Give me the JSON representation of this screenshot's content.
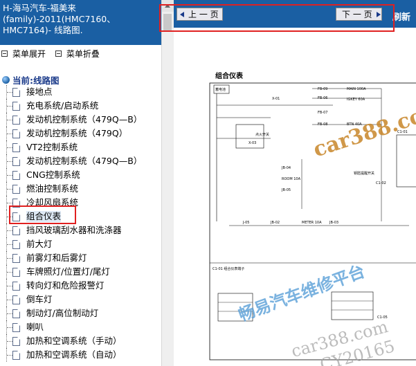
{
  "sidebar": {
    "title_lines": [
      "H-海马汽车-福美来",
      "(family)-2011(HMC7160、",
      "HMC7164)- 线路图."
    ],
    "expand_label": "菜单展开",
    "collapse_label": "菜单折叠",
    "tree_root": "当前:线路图",
    "items": [
      {
        "label": "接地点"
      },
      {
        "label": "充电系统/启动系统"
      },
      {
        "label": "发动机控制系统（479Q—B）"
      },
      {
        "label": "发动机控制系统（479Q）"
      },
      {
        "label": "VT2控制系统"
      },
      {
        "label": "发动机控制系统（479Q—B）"
      },
      {
        "label": "CNG控制系统"
      },
      {
        "label": "燃油控制系统"
      },
      {
        "label": "冷却风扇系统"
      },
      {
        "label": "组合仪表"
      },
      {
        "label": "挡风玻璃刮水器和洗涤器"
      },
      {
        "label": "前大灯"
      },
      {
        "label": "前雾灯和后雾灯"
      },
      {
        "label": "车牌照灯/位置灯/尾灯"
      },
      {
        "label": "转向灯和危险报警灯"
      },
      {
        "label": "倒车灯"
      },
      {
        "label": "制动灯/高位制动灯"
      },
      {
        "label": "喇叭"
      },
      {
        "label": "加热和空调系统（手动）"
      },
      {
        "label": "加热和空调系统（自动）"
      }
    ],
    "selected_index": 9
  },
  "toolbar": {
    "prev_label": "上 一 页",
    "next_label": "下 一 页",
    "refresh_label": "刷新"
  },
  "diagram": {
    "title": "组合仪表",
    "labels": {
      "fuse_box": "蓄电池",
      "ignition_switch": "点火开关",
      "lighting_control": "钥匙提醒开关",
      "ground": "C1-01 组合仪表端子",
      "f8": "FB-09",
      "f6": "FB-06",
      "f7": "FB-07",
      "f5": "FB-08",
      "main": "MAIN 100A",
      "igkey": "IGKEY 60A",
      "btn": "BTN 40A",
      "room": "ROOM 10A",
      "meter": "METER 10A",
      "x01": "X-01",
      "x03": "X-03",
      "jb04": "JB-04",
      "jb05": "JB-05",
      "jb02": "JB-02",
      "jb03": "JB-03",
      "c1": "C1-01",
      "c2": "C1-02",
      "d5": "J-05",
      "c5": "C1-05"
    }
  },
  "watermarks": {
    "site": "car388.com",
    "platform": "畅易汽车维修平台",
    "site2": "car388.com",
    "code": "CY20165"
  }
}
